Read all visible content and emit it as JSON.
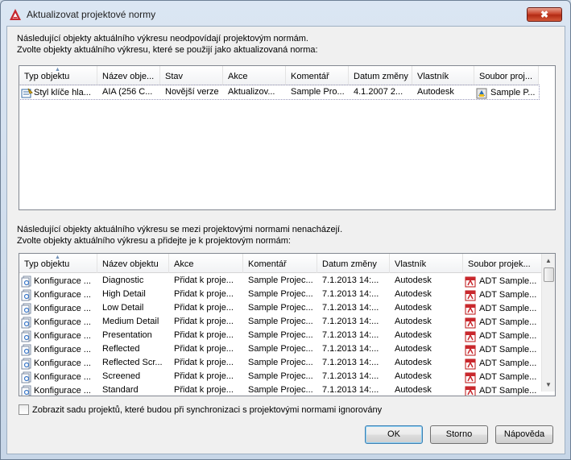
{
  "window": {
    "title": "Aktualizovat projektové normy",
    "close_label": "✖"
  },
  "top_section": {
    "line1": "Následující objekty aktuálního výkresu neodpovídají projektovým normám.",
    "line2": "Zvolte objekty aktuálního výkresu, které se použijí jako aktualizovaná norma:",
    "columns": [
      "Typ objektu",
      "Název obje...",
      "Stav",
      "Akce",
      "Komentář",
      "Datum změny",
      "Vlastník",
      "Soubor proj..."
    ],
    "rows": [
      {
        "type": "Styl klíče hla...",
        "name": "AIA (256 C...",
        "status": "Novější verze",
        "action": "Aktualizov...",
        "comment": "Sample Pro...",
        "date": "4.1.2007 2...",
        "owner": "Autodesk",
        "file": "Sample P..."
      }
    ]
  },
  "bottom_section": {
    "line1": "Následující objekty aktuálního výkresu se mezi projektovými normami nenacházejí.",
    "line2": "Zvolte objekty aktuálního výkresu a přidejte je k projektovým normám:",
    "columns": [
      "Typ objektu",
      "Název objektu",
      "Akce",
      "Komentář",
      "Datum změny",
      "Vlastník",
      "Soubor projek..."
    ],
    "rows": [
      {
        "type": "Konfigurace ...",
        "name": "Diagnostic",
        "action": "Přidat k proje...",
        "comment": "Sample Projec...",
        "date": "7.1.2013 14:...",
        "owner": "Autodesk",
        "file": "ADT Sample..."
      },
      {
        "type": "Konfigurace ...",
        "name": "High Detail",
        "action": "Přidat k proje...",
        "comment": "Sample Projec...",
        "date": "7.1.2013 14:...",
        "owner": "Autodesk",
        "file": "ADT Sample..."
      },
      {
        "type": "Konfigurace ...",
        "name": "Low Detail",
        "action": "Přidat k proje...",
        "comment": "Sample Projec...",
        "date": "7.1.2013 14:...",
        "owner": "Autodesk",
        "file": "ADT Sample..."
      },
      {
        "type": "Konfigurace ...",
        "name": "Medium Detail",
        "action": "Přidat k proje...",
        "comment": "Sample Projec...",
        "date": "7.1.2013 14:...",
        "owner": "Autodesk",
        "file": "ADT Sample..."
      },
      {
        "type": "Konfigurace ...",
        "name": "Presentation",
        "action": "Přidat k proje...",
        "comment": "Sample Projec...",
        "date": "7.1.2013 14:...",
        "owner": "Autodesk",
        "file": "ADT Sample..."
      },
      {
        "type": "Konfigurace ...",
        "name": "Reflected",
        "action": "Přidat k proje...",
        "comment": "Sample Projec...",
        "date": "7.1.2013 14:...",
        "owner": "Autodesk",
        "file": "ADT Sample..."
      },
      {
        "type": "Konfigurace ...",
        "name": "Reflected Scr...",
        "action": "Přidat k proje...",
        "comment": "Sample Projec...",
        "date": "7.1.2013 14:...",
        "owner": "Autodesk",
        "file": "ADT Sample..."
      },
      {
        "type": "Konfigurace ...",
        "name": "Screened",
        "action": "Přidat k proje...",
        "comment": "Sample Projec...",
        "date": "7.1.2013 14:...",
        "owner": "Autodesk",
        "file": "ADT Sample..."
      },
      {
        "type": "Konfigurace ...",
        "name": "Standard",
        "action": "Přidat k proje...",
        "comment": "Sample Projec...",
        "date": "7.1.2013 14:...",
        "owner": "Autodesk",
        "file": "ADT Sample..."
      }
    ]
  },
  "checkbox": {
    "label": "Zobrazit sadu projektů, které budou při synchronizaci s projektovými normami ignorovány",
    "checked": false
  },
  "buttons": {
    "ok": "OK",
    "cancel": "Storno",
    "help": "Nápověda"
  },
  "icons": {
    "app": "autocad-logo-icon",
    "row_type": "display-config-icon",
    "file": "pdf-file-icon"
  }
}
